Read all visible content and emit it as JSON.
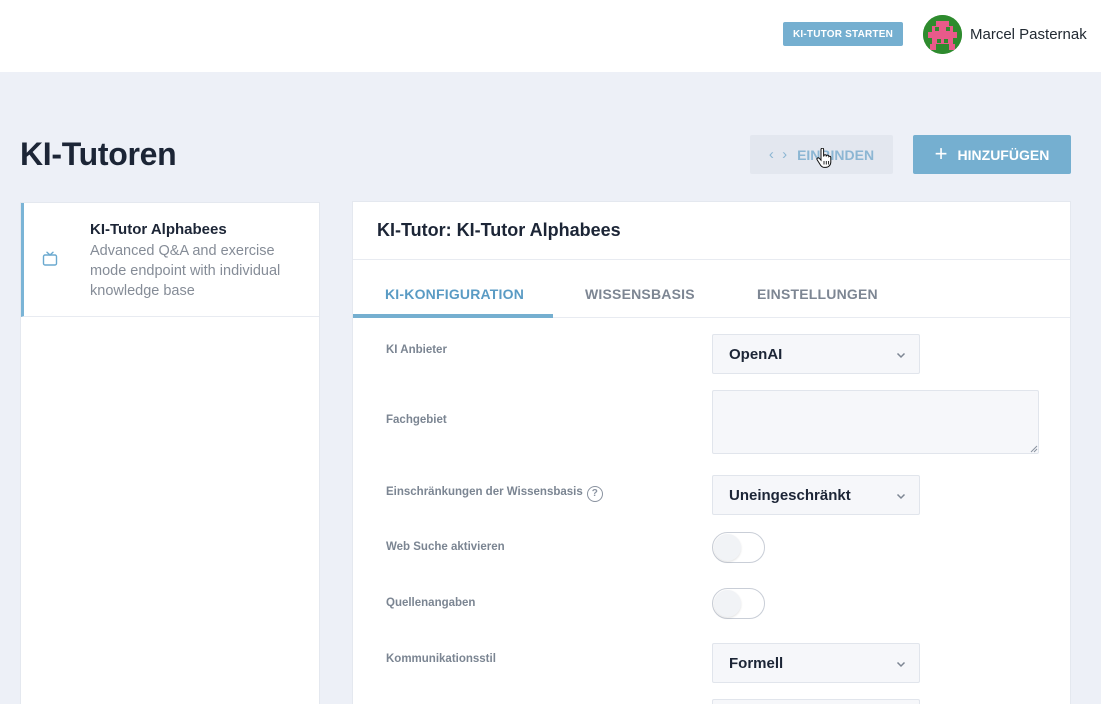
{
  "header": {
    "start_button_label": "KI-TUTOR STARTEN",
    "user_name": "Marcel Pasternak"
  },
  "page": {
    "title": "KI-Tutoren",
    "embed_button_label": "EINBINDEN",
    "add_button_label": "HINZUFÜGEN"
  },
  "tutor_list": {
    "items": [
      {
        "title": "KI-Tutor Alphabees",
        "description": "Advanced Q&A and exercise mode endpoint with individual knowledge base"
      }
    ]
  },
  "detail": {
    "title": "KI-Tutor: KI-Tutor Alphabees",
    "tabs": [
      {
        "label": "KI-KONFIGURATION",
        "active": true
      },
      {
        "label": "WISSENSBASIS",
        "active": false
      },
      {
        "label": "EINSTELLUNGEN",
        "active": false
      }
    ],
    "form": {
      "provider_label": "KI Anbieter",
      "provider_value": "OpenAI",
      "subject_label": "Fachgebiet",
      "subject_value": "",
      "restriction_label": "Einschränkungen der Wissensbasis",
      "restriction_help": "?",
      "restriction_value": "Uneingeschränkt",
      "websearch_label": "Web Suche aktivieren",
      "websearch_enabled": false,
      "sources_label": "Quellenangaben",
      "sources_enabled": false,
      "style_label": "Kommunikationsstil",
      "style_value": "Formell"
    }
  },
  "colors": {
    "accent": "#75afd0",
    "background": "#edf0f7",
    "text_dark": "#1c2536",
    "text_muted": "#7b8592"
  },
  "icons": {
    "embed": "code-icon",
    "add": "plus-icon",
    "list_item": "tv-icon",
    "select": "chevron-down-icon",
    "help": "help-circle-icon"
  }
}
